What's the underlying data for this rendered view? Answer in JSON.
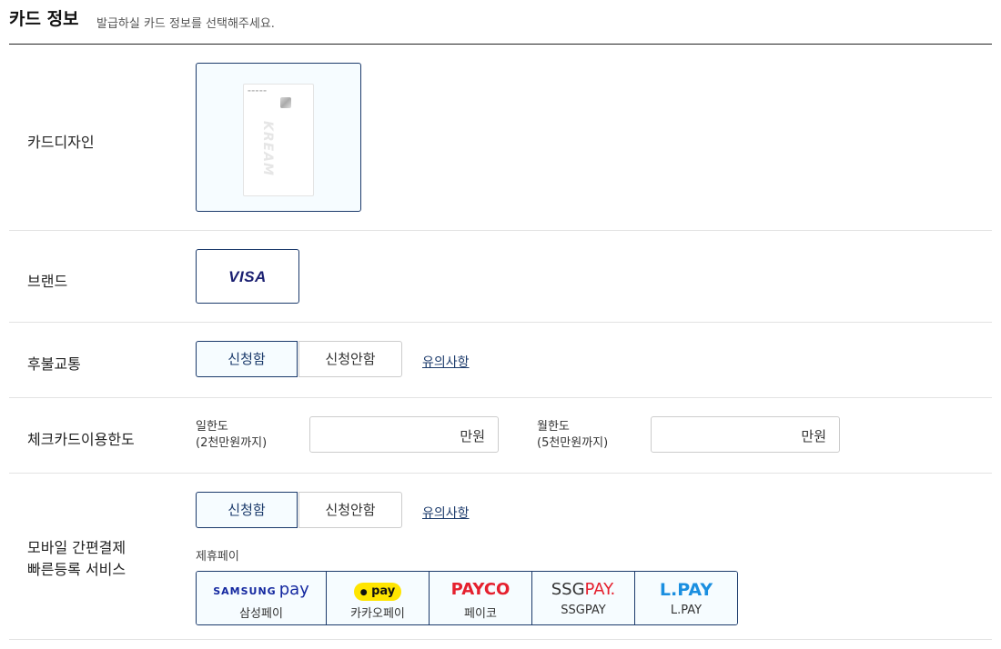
{
  "header": {
    "title": "카드 정보",
    "desc": "발급하실 카드 정보를 선택해주세요."
  },
  "card_design": {
    "label": "카드디자인",
    "card_text": "KREAM"
  },
  "brand": {
    "label": "브랜드",
    "value": "VISA"
  },
  "transit": {
    "label": "후불교통",
    "apply": "신청함",
    "decline": "신청안함",
    "notice": "유의사항",
    "selected": "신청함"
  },
  "check_limit": {
    "label": "체크카드이용한도",
    "daily": {
      "label1": "일한도",
      "label2": "(2천만원까지)",
      "unit": "만원"
    },
    "monthly": {
      "label1": "월한도",
      "label2": "(5천만원까지)",
      "unit": "만원"
    }
  },
  "mobile_pay": {
    "label1": "모바일 간편결제",
    "label2": "빠른등록 서비스",
    "apply": "신청함",
    "decline": "신청안함",
    "notice": "유의사항",
    "selected": "신청함",
    "partner_label": "제휴페이",
    "pays": [
      {
        "logo": "SAMSUNG pay",
        "name": "삼성페이",
        "color": "#1428a0"
      },
      {
        "logo": "pay",
        "name": "카카오페이",
        "color": "#ffe500"
      },
      {
        "logo": "PAYCO",
        "name": "페이코",
        "color": "#e5202e"
      },
      {
        "logo": "SSGPAY.",
        "name": "SSGPAY",
        "color": "#333333"
      },
      {
        "logo": "L.PAY",
        "name": "L.PAY",
        "color": "#1b8fe0"
      }
    ]
  }
}
